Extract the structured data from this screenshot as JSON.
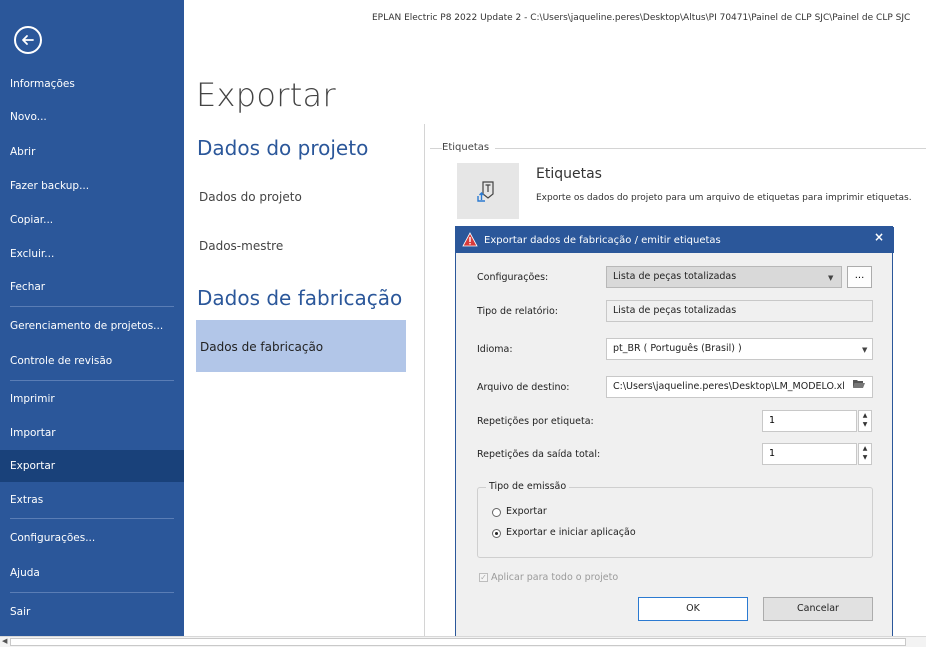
{
  "window": {
    "title": "EPLAN Electric P8 2022 Update 2 - C:\\Users\\jaqueline.peres\\Desktop\\Altus\\PI 70471\\Painel de CLP SJC\\Painel de CLP SJC"
  },
  "sidebar": {
    "items": [
      {
        "label": "Informações"
      },
      {
        "label": "Novo..."
      },
      {
        "label": "Abrir"
      },
      {
        "label": "Fazer backup..."
      },
      {
        "label": "Copiar..."
      },
      {
        "label": "Excluir..."
      },
      {
        "label": "Fechar"
      },
      {
        "label": "Gerenciamento de projetos..."
      },
      {
        "label": "Controle de revisão"
      },
      {
        "label": "Imprimir"
      },
      {
        "label": "Importar"
      },
      {
        "label": "Exportar",
        "active": true
      },
      {
        "label": "Extras"
      },
      {
        "label": "Configurações..."
      },
      {
        "label": "Ajuda"
      },
      {
        "label": "Sair"
      }
    ]
  },
  "main": {
    "heading": "Exportar",
    "sections": [
      {
        "title": "Dados do projeto",
        "links": [
          "Dados do projeto",
          "Dados-mestre"
        ]
      },
      {
        "title": "Dados de fabricação",
        "links": [
          "Dados de fabricação"
        ]
      }
    ],
    "group_label": "Etiquetas",
    "tile": {
      "title": "Etiquetas",
      "description": "Exporte os dados do projeto para um arquivo de etiquetas para imprimir etiquetas.",
      "icon": "label-export-icon"
    }
  },
  "dialog": {
    "title": "Exportar dados de fabricação / emitir etiquetas",
    "close": "×",
    "fields": {
      "config_label": "Configurações:",
      "config_value": "Lista de peças totalizadas",
      "config_more": "...",
      "report_type_label": "Tipo de relatório:",
      "report_type_value": "Lista de peças totalizadas",
      "language_label": "Idioma:",
      "language_value": "pt_BR ( Português (Brasil) )",
      "dest_label": "Arquivo de destino:",
      "dest_value": "C:\\Users\\jaqueline.peres\\Desktop\\LM_MODELO.xl",
      "rep_label_label": "Repetições por etiqueta:",
      "rep_label_value": "1",
      "rep_total_label": "Repetições da saída total:",
      "rep_total_value": "1"
    },
    "emission": {
      "legend": "Tipo de emissão",
      "options": [
        {
          "label": "Exportar",
          "selected": false
        },
        {
          "label": "Exportar e iniciar aplicação",
          "selected": true
        }
      ]
    },
    "apply_all": {
      "label": "Aplicar para todo o projeto",
      "checked": true,
      "disabled": true
    },
    "buttons": {
      "ok": "OK",
      "cancel": "Cancelar"
    }
  },
  "colors": {
    "sidebar_bg": "#2b579a",
    "sidebar_active": "#19417a",
    "accent": "#2b579a",
    "selected_nav": "#b2c6e8",
    "warning": "#d83b3b"
  }
}
